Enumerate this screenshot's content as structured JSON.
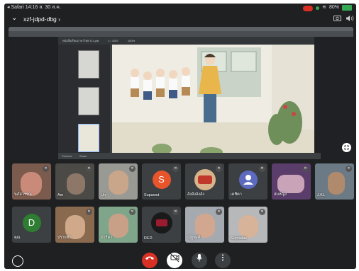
{
  "status_bar": {
    "app": "◂ Safari",
    "time": "14:16",
    "date": "ส. 30 ส.ค.",
    "battery": "80%"
  },
  "meet": {
    "meeting_code": "xzf-jdpd-dbg",
    "chevron": "chevron-down-icon",
    "camera_flip": "camera-flip-icon",
    "speaker": "speaker-icon"
  },
  "pdf": {
    "toolbar_items": [
      "หนังสือเรียนภาษาไทย ป.1.pdf",
      "1 / 1007",
      "100%"
    ],
    "page_number": "1",
    "bottom_items": [
      "Present",
      "Share"
    ]
  },
  "participants": [
    {
      "name": "นภัสวรรณ",
      "type": "video",
      "muted": true
    },
    {
      "name": "Am",
      "type": "video",
      "muted": true
    },
    {
      "name": "Un",
      "type": "video",
      "muted": true
    },
    {
      "name": "Supawut",
      "type": "avatar",
      "initial": "S",
      "color": "#e8542b",
      "muted": true
    },
    {
      "name": "อังอังอังอัง",
      "type": "logo",
      "muted": true
    },
    {
      "name": "เดชิตา",
      "type": "icon",
      "color": "#5c6bc0",
      "muted": true
    },
    {
      "name": "สมหญิง",
      "type": "video",
      "muted": true
    },
    {
      "name": "J.KL",
      "type": "video",
      "muted": true
    },
    {
      "name": "คุณ",
      "type": "avatar",
      "initial": "D",
      "color": "#2e7d32",
      "muted": false
    },
    {
      "name": "ปรายฟ้า",
      "type": "video",
      "muted": true
    },
    {
      "name": "ปาริดา",
      "type": "video",
      "muted": true
    },
    {
      "name": "RED",
      "type": "logo",
      "muted": true
    },
    {
      "name": "ณัฐพงศ์",
      "type": "video",
      "muted": true
    },
    {
      "name": "Suphalak",
      "type": "video",
      "muted": true
    }
  ],
  "controls": [
    {
      "name": "end-call",
      "icon": "phone-hangup-icon",
      "color": "#d93025"
    },
    {
      "name": "camera-off",
      "icon": "camera-off-icon",
      "color": "#ffffff"
    },
    {
      "name": "microphone",
      "icon": "microphone-icon",
      "color": "#3c4043"
    },
    {
      "name": "more-options",
      "icon": "more-vertical-icon",
      "color": "#3c4043"
    }
  ]
}
